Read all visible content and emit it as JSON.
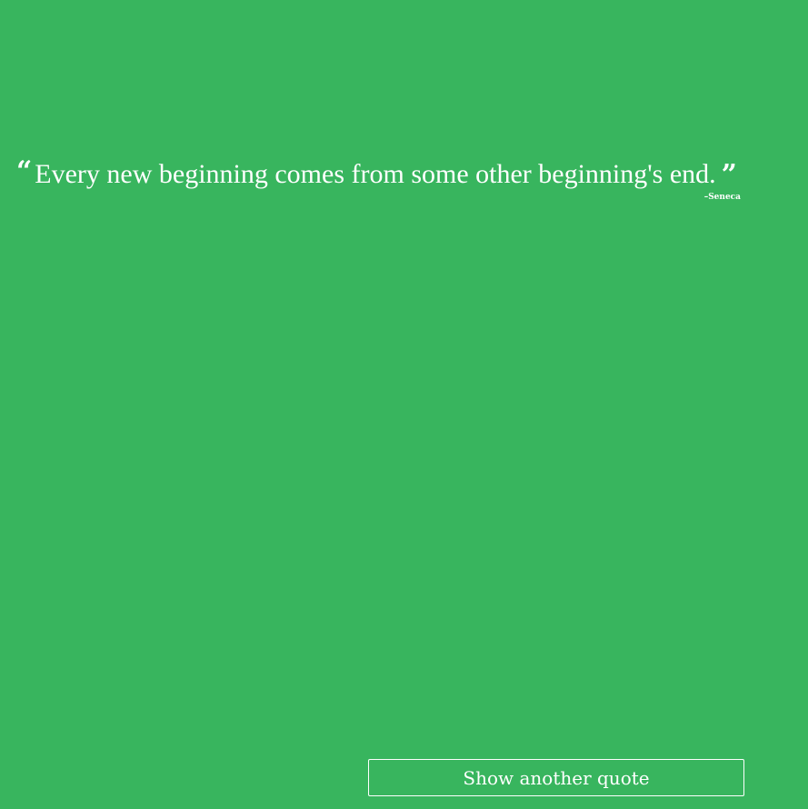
{
  "quote": {
    "open_mark": "“",
    "text": "Every new beginning comes from some other beginning's end.",
    "close_mark": "”",
    "author": "–Seneca"
  },
  "button": {
    "label": "Show another quote"
  },
  "colors": {
    "background": "#38b55e",
    "text": "#ffffff"
  }
}
